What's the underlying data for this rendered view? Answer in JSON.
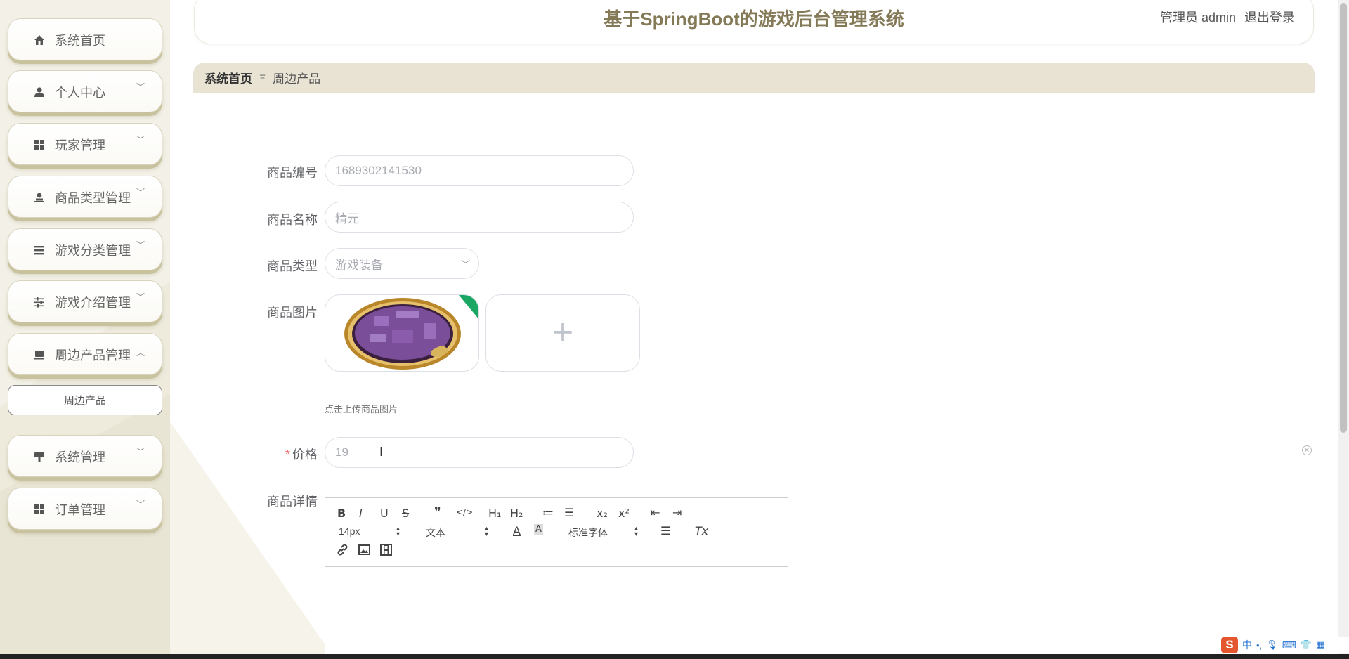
{
  "sidebar": {
    "items": [
      {
        "label": "系统首页",
        "icon": "home-icon",
        "expandable": false
      },
      {
        "label": "个人中心",
        "icon": "user-icon",
        "expandable": true
      },
      {
        "label": "玩家管理",
        "icon": "grid-icon",
        "expandable": true
      },
      {
        "label": "商品类型管理",
        "icon": "person-stamp-icon",
        "expandable": true
      },
      {
        "label": "游戏分类管理",
        "icon": "list-icon",
        "expandable": true
      },
      {
        "label": "游戏介绍管理",
        "icon": "sliders-icon",
        "expandable": true
      },
      {
        "label": "周边产品管理",
        "icon": "monitor-icon",
        "expandable": true,
        "expanded": true
      },
      {
        "label": "系统管理",
        "icon": "stand-icon",
        "expandable": true
      },
      {
        "label": "订单管理",
        "icon": "grid-icon",
        "expandable": true
      }
    ],
    "submenu": {
      "label": "周边产品"
    }
  },
  "header": {
    "title": "基于SpringBoot的游戏后台管理系统",
    "user": "管理员 admin",
    "logout": "退出登录"
  },
  "breadcrumb": {
    "home": "系统首页",
    "separator": "Ξ",
    "current": "周边产品"
  },
  "form": {
    "code": {
      "label": "商品编号",
      "value": "1689302141530"
    },
    "name": {
      "label": "商品名称",
      "value": "精元"
    },
    "type": {
      "label": "商品类型",
      "value": "游戏装备"
    },
    "image": {
      "label": "商品图片",
      "tip": "点击上传商品图片"
    },
    "price": {
      "label": "价格",
      "required_mark": "*",
      "value": "19"
    },
    "detail": {
      "label": "商品详情"
    }
  },
  "editor": {
    "font_size": "14px",
    "header": "文本",
    "font_family": "标准字体",
    "buttons": {
      "bold": "B",
      "italic": "I",
      "underline": "U",
      "strike": "S",
      "blockquote": "❞",
      "code": "</>",
      "h1": "H₁",
      "h2": "H₂",
      "ordered_list": "≔",
      "bullet_list": "☰",
      "subscript": "x₂",
      "superscript": "x²",
      "outdent": "⇤",
      "indent": "⇥",
      "color": "A",
      "background": "A",
      "align": "☰",
      "clean": "Tx"
    }
  },
  "colors": {
    "accent": "#847a57",
    "sidebar_bg": "#f3f1e7",
    "breadcrumb_bg": "#e8e3d3",
    "required": "#f56c6c"
  }
}
